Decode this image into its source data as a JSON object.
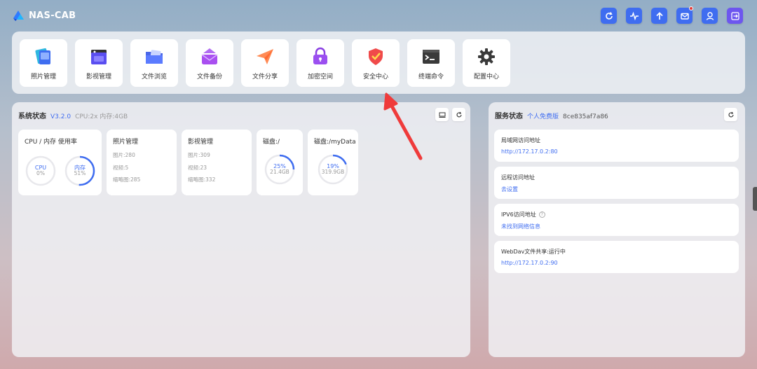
{
  "app": {
    "title": "NAS-CAB"
  },
  "header": {
    "buttons": [
      {
        "name": "refresh-button",
        "icon": "refresh-icon"
      },
      {
        "name": "activity-button",
        "icon": "pulse-icon"
      },
      {
        "name": "upload-button",
        "icon": "arrow-up-icon"
      },
      {
        "name": "mail-button",
        "icon": "mail-icon",
        "has_notification": true
      },
      {
        "name": "user-button",
        "icon": "user-icon"
      },
      {
        "name": "logout-button",
        "icon": "logout-icon"
      }
    ]
  },
  "apps": [
    {
      "label": "照片管理",
      "icon": "photos-icon"
    },
    {
      "label": "影视管理",
      "icon": "video-icon"
    },
    {
      "label": "文件浏览",
      "icon": "folder-icon"
    },
    {
      "label": "文件备份",
      "icon": "backup-icon"
    },
    {
      "label": "文件分享",
      "icon": "share-plane-icon"
    },
    {
      "label": "加密空间",
      "icon": "lock-icon"
    },
    {
      "label": "安全中心",
      "icon": "shield-icon"
    },
    {
      "label": "终端命令",
      "icon": "terminal-icon"
    },
    {
      "label": "配置中心",
      "icon": "gear-icon"
    }
  ],
  "system": {
    "title": "系统状态",
    "version": "V3.2.0",
    "specs": "CPU:2x 内存:4GB",
    "cpu_card": {
      "title": "CPU / 内存 使用率",
      "cpu": {
        "label": "CPU",
        "value": "0%",
        "percent": 0
      },
      "mem": {
        "label": "内存",
        "value": "51%",
        "percent": 51
      }
    },
    "photo_card": {
      "title": "照片管理",
      "line1": "图片:280",
      "line2": "视频:5",
      "line3": "缩略图:285"
    },
    "video_card": {
      "title": "影视管理",
      "line1": "图片:309",
      "line2": "视频:23",
      "line3": "缩略图:332"
    },
    "disk1": {
      "title": "磁盘:/",
      "value": "25%",
      "size": "21.4GB",
      "percent": 25
    },
    "disk2": {
      "title": "磁盘:/myData",
      "value": "19%",
      "size": "319.9GB",
      "percent": 19
    }
  },
  "services": {
    "title": "服务状态",
    "edition": "个人免费版",
    "id": "8ce835af7a86",
    "items": [
      {
        "label": "局域网访问地址",
        "value": "http://172.17.0.2:80"
      },
      {
        "label": "远程访问地址",
        "value": "去设置"
      },
      {
        "label": "IPV6访问地址",
        "value": "未找到网络信息"
      },
      {
        "label": "WebDav文件共享:运行中",
        "value": "http://172.17.0.2:90"
      }
    ]
  },
  "colors": {
    "accent": "#3f6df0",
    "annotation_arrow": "#ef3b3b"
  }
}
